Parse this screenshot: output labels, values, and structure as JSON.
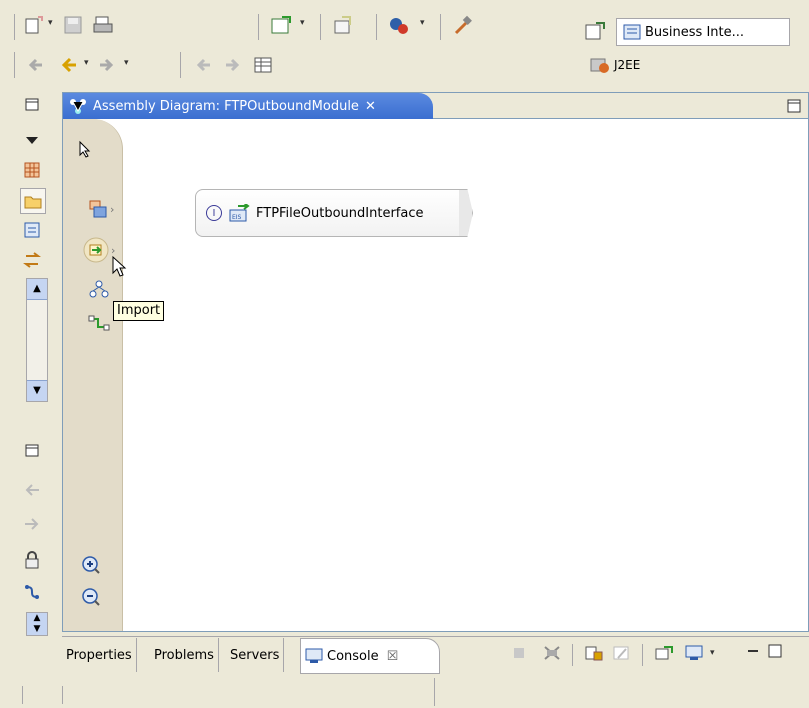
{
  "toolbar": {
    "icons_row1": [
      "new-wizard-icon",
      "save-icon",
      "print-icon",
      "open-type-icon",
      "export-icon",
      "run-icon",
      "hammer-icon"
    ],
    "icons_row2": [
      "back-icon",
      "forward-icon",
      "navigate-icon",
      "history-icon"
    ]
  },
  "perspectives": {
    "business_integration": "Business Inte...",
    "j2ee": "J2EE"
  },
  "editor": {
    "tab_title": "Assembly Diagram: FTPOutboundModule",
    "tab_close": "✕"
  },
  "diagram": {
    "component_label": "FTPFileOutboundInterface",
    "component_marker": "I",
    "tooltip": "Import"
  },
  "bottom_tabs": {
    "properties": "Properties",
    "problems": "Problems",
    "servers": "Servers",
    "console": "Console",
    "console_close": "☒"
  },
  "colors": {
    "chrome": "#ece9d8",
    "editor_tab": "#3a6ed0",
    "palette": "#e3dcc9",
    "canvas": "#ffffff"
  }
}
